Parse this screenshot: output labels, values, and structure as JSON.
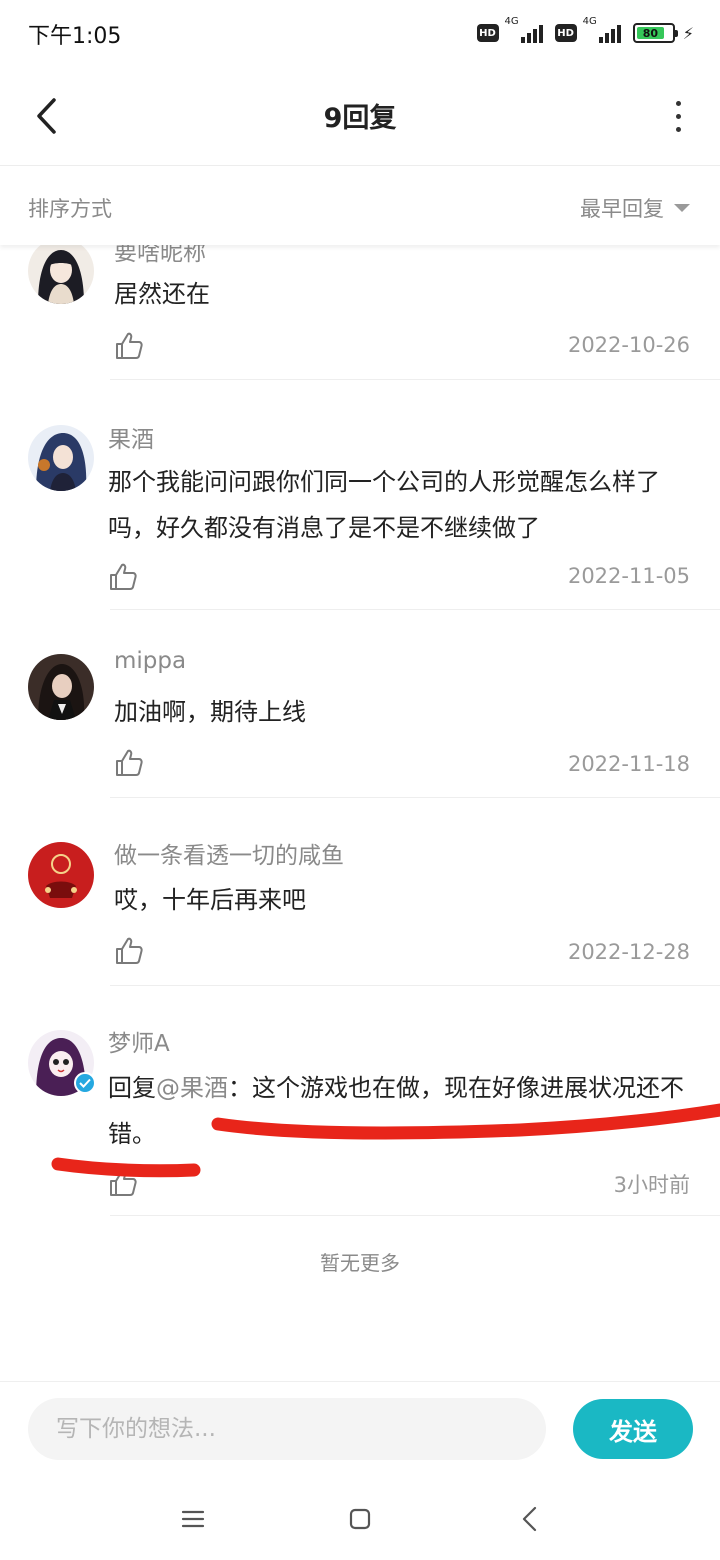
{
  "status_bar": {
    "time": "下午1:05",
    "hd1": "HD",
    "net1": "4G",
    "hd2": "HD",
    "net2": "4G",
    "battery": "80",
    "battery_level_percent": 80
  },
  "header": {
    "title": "9回复",
    "back_icon": "chevron-left-icon",
    "more_icon": "more-vertical-icon"
  },
  "sort": {
    "label": "排序方式",
    "selected": "最早回复"
  },
  "comments": [
    {
      "username": "要啥昵称",
      "content": "居然还在",
      "date": "2022-10-26"
    },
    {
      "username": "果酒",
      "content": "那个我能问问跟你们同一个公司的人形觉醒怎么样了吗，好久都没有消息了是不是不继续做了",
      "date": "2022-11-05"
    },
    {
      "username": "mippa",
      "content": "加油啊，期待上线",
      "date": "2022-11-18"
    },
    {
      "username": "做一条看透一切的咸鱼",
      "content": "哎，十年后再来吧",
      "date": "2022-12-28"
    },
    {
      "username": "梦师A",
      "reply_prefix": "回复",
      "mention": "@果酒",
      "content": "：这个游戏也在做，现在好像进展状况还不错。",
      "date": "3小时前"
    }
  ],
  "list_footer": "暂无更多",
  "input": {
    "placeholder": "写下你的想法...",
    "send_label": "发送"
  },
  "colors": {
    "accent": "#1ab8c4",
    "annotation": "#e8251a",
    "secondary_text": "#8a8a8a"
  },
  "nav": {
    "menu_icon": "menu-icon",
    "home_icon": "square-icon",
    "back_icon": "triangle-back-icon"
  }
}
